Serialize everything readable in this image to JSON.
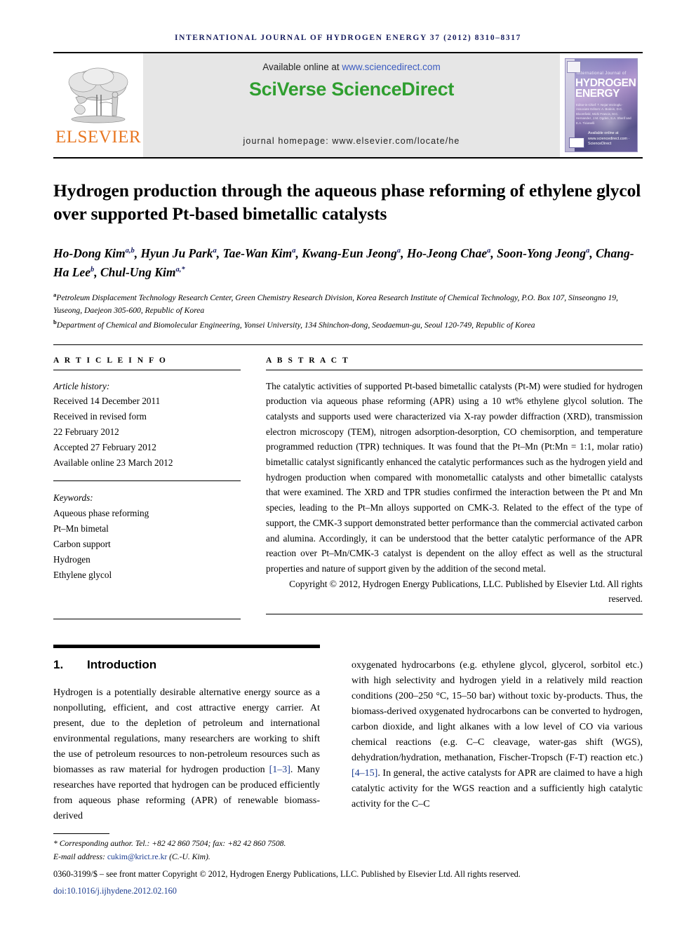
{
  "running_head": "INTERNATIONAL JOURNAL OF HYDROGEN ENERGY 37 (2012) 8310–8317",
  "masthead": {
    "publisher_name": "ELSEVIER",
    "available_prefix": "Available online at ",
    "available_url": "www.sciencedirect.com",
    "brand_part1": "SciVerse",
    "brand_part2": "ScienceDirect",
    "homepage": "journal homepage: www.elsevier.com/locate/he",
    "cover": {
      "line_small": "International Journal of",
      "line_big1": "HYDROGEN",
      "line_big2": "ENERGY",
      "editors": "Editor-in-Chief:  T. Nejat Veziroglu  ·  Associate Editors:  A. Bodein, D.C. Bloomfield, Michi Francis, M.C. Hernandez, J.M. Ogden, S.A. Sherif and E.A. Ticianelli",
      "science_direct": "Available online at www.sciencedirect.com  ·  ScienceDirect"
    }
  },
  "title": "Hydrogen production through the aqueous phase reforming of ethylene glycol over supported Pt-based bimetallic catalysts",
  "authors": [
    {
      "name": "Ho-Dong Kim",
      "sup": "a,b"
    },
    {
      "name": "Hyun Ju Park",
      "sup": "a"
    },
    {
      "name": "Tae-Wan Kim",
      "sup": "a"
    },
    {
      "name": "Kwang-Eun Jeong",
      "sup": "a"
    },
    {
      "name": "Ho-Jeong Chae",
      "sup": "a"
    },
    {
      "name": "Soon-Yong Jeong",
      "sup": "a"
    },
    {
      "name": "Chang-Ha Lee",
      "sup": "b"
    },
    {
      "name": "Chul-Ung Kim",
      "sup": "a,*"
    }
  ],
  "affiliations": [
    {
      "marker": "a",
      "text": "Petroleum Displacement Technology Research Center, Green Chemistry Research Division, Korea Research Institute of Chemical Technology, P.O. Box 107, Sinseongno 19, Yuseong, Daejeon 305-600, Republic of Korea"
    },
    {
      "marker": "b",
      "text": "Department of Chemical and Biomolecular Engineering, Yonsei University, 134 Shinchon-dong, Seodaemun-gu, Seoul 120-749, Republic of Korea"
    }
  ],
  "article_info": {
    "heading": "A R T I C L E   I N F O",
    "history_label": "Article history:",
    "history": [
      "Received 14 December 2011",
      "Received in revised form",
      "22 February 2012",
      "Accepted 27 February 2012",
      "Available online 23 March 2012"
    ],
    "keywords_label": "Keywords:",
    "keywords": [
      "Aqueous phase reforming",
      "Pt–Mn bimetal",
      "Carbon support",
      "Hydrogen",
      "Ethylene glycol"
    ]
  },
  "abstract": {
    "heading": "A B S T R A C T",
    "text": "The catalytic activities of supported Pt-based bimetallic catalysts (Pt-M) were studied for hydrogen production via aqueous phase reforming (APR) using a 10 wt% ethylene glycol solution. The catalysts and supports used were characterized via X-ray powder diffraction (XRD), transmission electron microscopy (TEM), nitrogen adsorption-desorption, CO chemisorption, and temperature programmed reduction (TPR) techniques. It was found that the Pt–Mn (Pt:Mn = 1:1, molar ratio) bimetallic catalyst significantly enhanced the catalytic performances such as the hydrogen yield and hydrogen production when compared with monometallic catalysts and other bimetallic catalysts that were examined. The XRD and TPR studies confirmed the interaction between the Pt and Mn species, leading to the Pt–Mn alloys supported on CMK-3. Related to the effect of the type of support, the CMK-3 support demonstrated better performance than the commercial activated carbon and alumina. Accordingly, it can be understood that the better catalytic performance of the APR reaction over Pt–Mn/CMK-3 catalyst is dependent on the alloy effect as well as the structural properties and nature of support given by the addition of the second metal.",
    "copyright": "Copyright © 2012, Hydrogen Energy Publications, LLC. Published by Elsevier Ltd. All rights reserved."
  },
  "body": {
    "section_number": "1.",
    "section_title": "Introduction",
    "left_paragraph_pre": "Hydrogen is a potentially desirable alternative energy source as a nonpolluting, efficient, and cost attractive energy carrier. At present, due to the depletion of petroleum and international environmental regulations, many researchers are working to shift the use of petroleum resources to non-petroleum resources such as biomasses as raw material for hydrogen production ",
    "left_ref": "[1–3]",
    "left_paragraph_post": ". Many researches have reported that hydrogen can be produced efficiently from aqueous phase reforming (APR) of renewable biomass-derived",
    "right_paragraph_pre": "oxygenated hydrocarbons (e.g. ethylene glycol, glycerol, sorbitol etc.) with high selectivity and hydrogen yield in a relatively mild reaction conditions (200–250 °C, 15–50 bar) without toxic by-products. Thus, the biomass-derived oxygenated hydrocarbons can be converted to hydrogen, carbon dioxide, and light alkanes with a low level of CO via various chemical reactions (e.g. C–C cleavage, water-gas shift (WGS), dehydration/hydration, methanation, Fischer-Tropsch (F-T) reaction etc.) ",
    "right_ref": "[4–15]",
    "right_paragraph_post": ". In general, the active catalysts for APR are claimed to have a high catalytic activity for the WGS reaction and a sufficiently high catalytic activity for the C–C"
  },
  "footnotes": {
    "corresponding": "Corresponding author. Tel.: +82 42 860 7504; fax: +82 42 860 7508.",
    "email_label": "E-mail address: ",
    "email": "cukim@krict.re.kr",
    "email_suffix": " (C.-U. Kim).",
    "issn_line": "0360-3199/$ – see front matter Copyright © 2012, Hydrogen Energy Publications, LLC. Published by Elsevier Ltd. All rights reserved.",
    "doi": "doi:10.1016/j.ijhydene.2012.02.160"
  },
  "colors": {
    "running_head": "#1a2060",
    "elsevier_orange": "#E87722",
    "sciencedirect_green": "#2f9e2f",
    "link_blue": "#3b5bc0",
    "ref_blue": "#1a3a8f"
  }
}
